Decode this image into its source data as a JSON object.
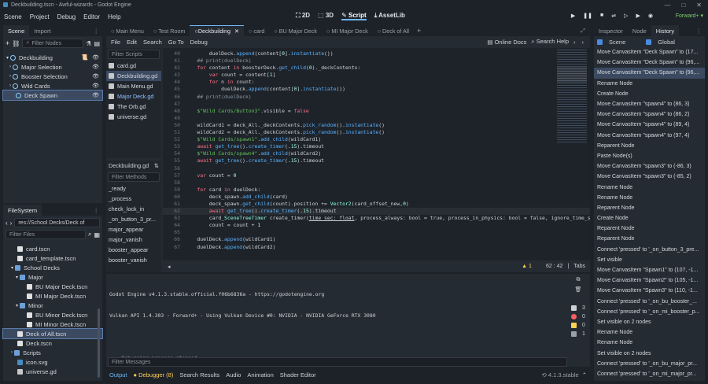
{
  "window_title": "Deckbuilding.tscn - Awful-wizards - Godot Engine",
  "menu": [
    "Scene",
    "Project",
    "Debug",
    "Editor",
    "Help"
  ],
  "workspaces": [
    {
      "label": "2D"
    },
    {
      "label": "3D"
    },
    {
      "label": "Script"
    },
    {
      "label": "AssetLib"
    }
  ],
  "renderer": "Forward+",
  "scene_dock": {
    "tabs": [
      "Scene",
      "Import"
    ],
    "filter_placeholder": "Filter Nodes",
    "nodes": [
      {
        "label": "Deckbuilding",
        "color": "#8fd0ff"
      },
      {
        "label": "Major Selection",
        "color": "#8fd0ff"
      },
      {
        "label": "Booster Selection",
        "color": "#8fd0ff"
      },
      {
        "label": "Wild Cards",
        "color": "#8fd0ff"
      },
      {
        "label": "Deck Spawn",
        "color": "#8fd0ff"
      }
    ]
  },
  "filesystem": {
    "tab": "FileSystem",
    "path": "res://School Decks/Deck of",
    "filter_placeholder": "Filter Files",
    "items": [
      {
        "label": "card.tscn"
      },
      {
        "label": "card_template.tscn"
      },
      {
        "label": "School Decks"
      },
      {
        "label": "Major"
      },
      {
        "label": "BU Major Deck.tscn"
      },
      {
        "label": "MI Major Deck.tscn"
      },
      {
        "label": "Minor"
      },
      {
        "label": "BU Minor Deck.tscn"
      },
      {
        "label": "MI Minor Deck.tscn"
      },
      {
        "label": "Deck of All.tscn"
      },
      {
        "label": "Deck.tscn"
      },
      {
        "label": "Scripts"
      },
      {
        "label": "icon.svg"
      },
      {
        "label": "universe.gd"
      }
    ]
  },
  "editor_tabs": [
    "Main Menu",
    "Test Room",
    "Deckbuilding",
    "card",
    "BU Major Deck",
    "MI Major Deck",
    "Deck of All"
  ],
  "script_menu": [
    "File",
    "Edit",
    "Search",
    "Go To",
    "Debug"
  ],
  "script_toolbar": {
    "docs": "Online Docs",
    "help": "Search Help"
  },
  "scripts_filter_placeholder": "Filter Scripts",
  "scripts": [
    "card.gd",
    "Deckbuilding.gd",
    "Main Menu.gd",
    "Major Deck.gd",
    "The Orb.gd",
    "universe.gd"
  ],
  "current_script": "Deckbuilding.gd",
  "methods_filter_placeholder": "Filter Methods",
  "methods": [
    "_ready",
    "_process",
    "check_lock_in",
    "_on_button_3_pr...",
    "major_appear",
    "major_vanish",
    "booster_appear",
    "booster_vanish"
  ],
  "code_lines": [
    {
      "n": "40",
      "html": "        duelDeck.<span class='fn'>append</span>(content[<span class='num'>0</span>].<span class='fn'>instantiate</span>())"
    },
    {
      "n": "41",
      "html": "<span class='cm'>    ## print(duelDeck)</span>"
    },
    {
      "n": "42",
      "html": "    <span class='kw'>for</span> content <span class='kw'>in</span> boosterDeck.<span class='fn'>get_child</span>(<span class='num'>0</span>)._deckContents:"
    },
    {
      "n": "43",
      "html": "        <span class='kw'>var</span> count = content[<span class='num'>1</span>]"
    },
    {
      "n": "44",
      "html": "        <span class='kw'>for</span> n <span class='kw'>in</span> count:"
    },
    {
      "n": "45",
      "html": "            duelDeck.<span class='fn'>append</span>(content[<span class='num'>0</span>].<span class='fn'>instantiate</span>())"
    },
    {
      "n": "46",
      "html": "<span class='cm'>    ## print(duelDeck)</span>"
    },
    {
      "n": "47",
      "html": ""
    },
    {
      "n": "48",
      "html": "    <span class='nd'>$\"Wild Cards/Button3\"</span>.visible = <span class='kw'>false</span>"
    },
    {
      "n": "49",
      "html": ""
    },
    {
      "n": "50",
      "html": "    wildCard1 = deck_All._deckContents.<span class='fn'>pick_random</span>().<span class='fn'>instantiate</span>()"
    },
    {
      "n": "51",
      "html": "    wildCard2 = deck_All._deckContents.<span class='fn'>pick_random</span>().<span class='fn'>instantiate</span>()"
    },
    {
      "n": "52",
      "html": "    <span class='nd'>$\"Wild Cards/spawn1\"</span>.<span class='fn'>add_child</span>(wildCard1)"
    },
    {
      "n": "53",
      "html": "    <span class='kw'>await</span> <span class='fn'>get_tree</span>().<span class='fn'>create_timer</span>(<span class='num'>.15</span>).timeout"
    },
    {
      "n": "54",
      "html": "    <span class='nd'>$\"Wild Cards/spawn4\"</span>.<span class='fn'>add_child</span>(wildCard2)"
    },
    {
      "n": "55",
      "html": "    <span class='kw'>await</span> <span class='fn'>get_tree</span>().<span class='fn'>create_timer</span>(<span class='num'>.15</span>).timeout"
    },
    {
      "n": "56",
      "html": ""
    },
    {
      "n": "57",
      "html": "    <span class='kw'>var</span> count = <span class='num'>0</span>"
    },
    {
      "n": "58",
      "html": ""
    },
    {
      "n": "59",
      "html": "    <span class='kw'>for</span> card <span class='kw'>in</span> duelDeck:"
    },
    {
      "n": "60",
      "html": "        deck_spawn.<span class='fn'>add_child</span>(card)"
    },
    {
      "n": "61",
      "html": "        deck_spawn.<span class='fn'>get_child</span>(count).position += <span class='ty'>Vector2</span>(card_offset_new,<span class='num'>0</span>)"
    },
    {
      "n": "62",
      "html": "        <span class='kw'>await</span> <span class='fn'>get_tree</span>().<span class='fn'>create_timer</span>(<span class='num'>.15</span>).timeout"
    },
    {
      "n": "63",
      "html": "        card_<span class='ty'>SceneTreeTimer</span> create_timer(<u>time_sec: float</u>, process_always: bool = true, process_in_physics: bool = false, ignore_time_sca"
    },
    {
      "n": "64",
      "html": "        count = count + <span class='num'>1</span>"
    },
    {
      "n": "65",
      "html": ""
    },
    {
      "n": "66",
      "html": "    duelDeck.<span class='fn'>append</span>(wildCard1)"
    },
    {
      "n": "67",
      "html": "    duelDeck.<span class='fn'>append</span>(wildCard2)"
    }
  ],
  "status": {
    "warnings": "1",
    "position": "62  :  42",
    "indent": "Tabs"
  },
  "output_lines": [
    "Godot Engine v4.1.3.stable.official.f06b6836a - https://godotengine.org",
    "Vulkan API 1.4.303 - Forward+ - Using Vulkan Device #0: NVIDIA - NVIDIA GeForce RTX 3080",
    "",
    "--- Debugging process stopped ---"
  ],
  "output_badges": [
    "3",
    "0",
    "0",
    "1"
  ],
  "filter_messages_placeholder": "Filter Messages",
  "bottom_tabs": [
    "Output",
    "Debugger (8)",
    "Search Results",
    "Audio",
    "Animation",
    "Shader Editor"
  ],
  "version": "4.1.3.stable",
  "right_tabs": [
    "Inspector",
    "Node",
    "History"
  ],
  "history_scope": {
    "scene": "Scene",
    "global": "Global"
  },
  "history": [
    "Move CanvasItem \"Deck Spawn\" to (17...",
    "Move CanvasItem \"Deck Spawn\" to (96,...",
    "Move CanvasItem \"Deck Spawn\" to (96,...",
    "Rename Node",
    "Create Node",
    "Move CanvasItem \"spawn4\" to (86, 3)",
    "Move CanvasItem \"spawn4\" to (86, 2)",
    "Move CanvasItem \"spawn4\" to (89, 4)",
    "Move CanvasItem \"spawn4\" to (97, 4)",
    "Reparent Node",
    "Paste Node(s)",
    "Move CanvasItem \"spawn3\" to (-86, 3)",
    "Move CanvasItem \"spawn3\" to (-85, 2)",
    "Rename Node",
    "Rename Node",
    "Reparent Node",
    "Create Node",
    "Reparent Node",
    "Reparent Node",
    "Connect 'pressed' to '_on_button_3_pre...",
    "Set visible",
    "Move CanvasItem \"Spawn1\" to (107, -1...",
    "Move CanvasItem \"Spawn2\" to (105, -1...",
    "Move CanvasItem \"Spawn3\" to (110, -1...",
    "Connect 'pressed' to '_on_bu_booster_...",
    "Connect 'pressed' to '_on_mi_booster_p...",
    "Set visible on 2 nodes",
    "Rename Node",
    "Rename Node",
    "Set visible on 2 nodes",
    "Connect 'pressed' to '_on_bu_major_pr...",
    "Connect 'pressed' to '_on_mi_major_pr..."
  ]
}
